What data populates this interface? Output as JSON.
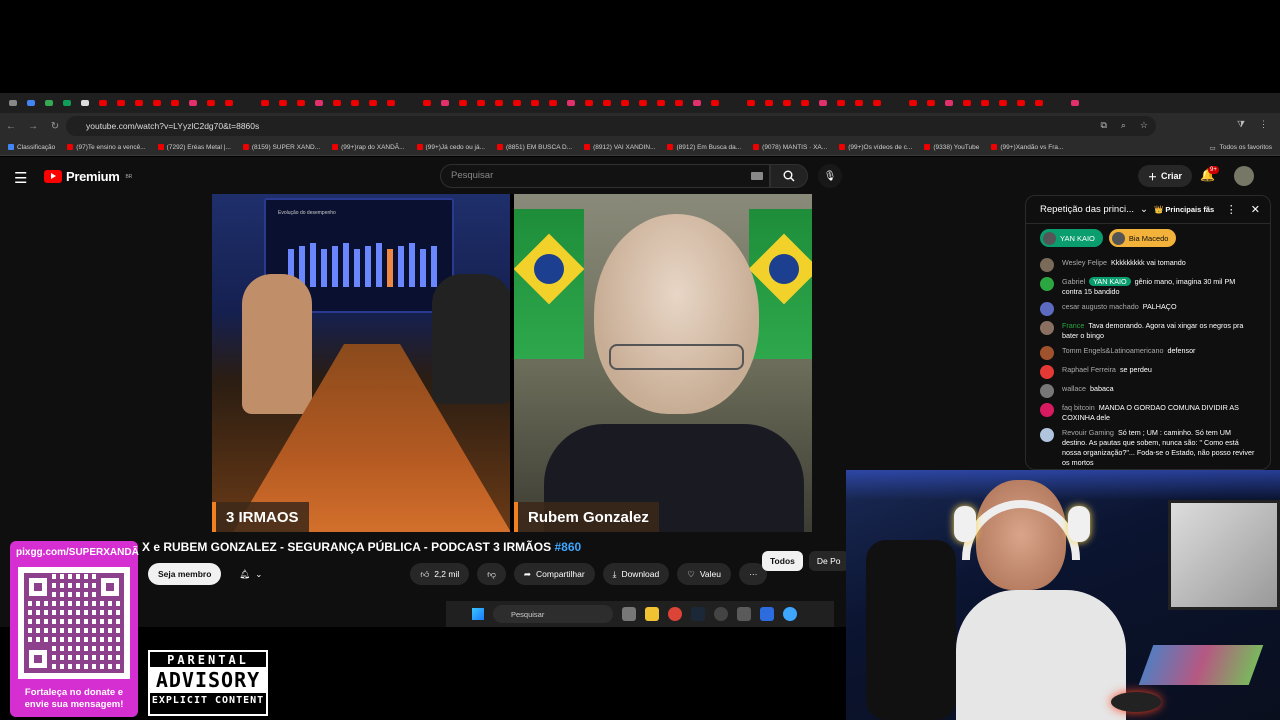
{
  "browser": {
    "url": "youtube.com/watch?v=LYyzlC2dg70&t=8860s",
    "bookmarks": [
      "Classificação",
      "(97)Te ensino a vencê...",
      "(7292) Eréas Metal |...",
      "(8159) SUPER XAND...",
      "(99+)rap do XANDÃ...",
      "(99+)Já cedo ou já...",
      "(8851) EM BUSCA D...",
      "(8912) VAI XANDIN...",
      "(8912) Em Busca da...",
      "(9078) MANTIS · XA...",
      "(99+)Os vídeos de c...",
      "(9338) YouTube",
      "(99+)Xandão vs Fra..."
    ],
    "favorites_label": "Todos os favoritos"
  },
  "youtube": {
    "logo_text": "Premium",
    "logo_sup": "BR",
    "search_placeholder": "Pesquisar",
    "create_label": "Criar",
    "notif_badge": "9+",
    "video": {
      "left_caption": "3 IRMAOS",
      "right_caption": "Rubem Gonzalez",
      "monitor_title": "Evolução do desempenho"
    },
    "title": "X e RUBEM GONZALEZ - SEGURANÇA PÚBLICA - PODCAST 3 IRMÃOS",
    "title_hash": "#860",
    "actions": {
      "member": "Seja membro",
      "likes": "2,2 mil",
      "share": "Compartilhar",
      "download": "Download",
      "thanks": "Valeu"
    },
    "chips": [
      "Todos",
      "De Po"
    ]
  },
  "chat": {
    "header": "Repetição das princi...",
    "fans_label": "Principais fãs",
    "pinned": [
      {
        "name": "YAN KAIO",
        "style": "green"
      },
      {
        "name": "Bia Macedo",
        "style": "gold"
      }
    ],
    "messages": [
      {
        "author": "Wesley Felipe",
        "badge": "",
        "text": "Kkkkkkkkk vai tomando",
        "color": "#7a6a5a"
      },
      {
        "author": "Gabriel",
        "badge": "YAN KAIO",
        "text": "gênio mano, imagina 30 mil PM contra 15 bandido",
        "color": "#2ba640"
      },
      {
        "author": "cesar augusto machado",
        "badge": "",
        "text": "PALHAÇO",
        "color": "#5c6bc0"
      },
      {
        "author": "France",
        "badge": "",
        "text": "Tava demorando. Agora vai xingar os negros pra bater o bingo",
        "color": "#8a7060",
        "mod": true
      },
      {
        "author": "Tomm Engels&Latinoamericano",
        "badge": "",
        "text": "defensor",
        "color": "#a0522d"
      },
      {
        "author": "Raphael Ferreira",
        "badge": "",
        "text": "se perdeu",
        "color": "#e53935"
      },
      {
        "author": "wallace",
        "badge": "",
        "text": "babaca",
        "color": "#777"
      },
      {
        "author": "faq bitcoin",
        "badge": "",
        "text": "MANDA O GORDAO COMUNA DIVIDIR AS COXINHA dele",
        "color": "#d81b60"
      },
      {
        "author": "Revouir Gaming",
        "badge": "",
        "text": "Só tem ; UM : caminho. Só tem UM destino. As pautas que sobem, nunca são: \" Como está nossa organização?\"... Foda-se o Estado, não posso reviver os mortos",
        "color": "#b0c4de"
      }
    ]
  },
  "taskbar": {
    "search_placeholder": "Pesquisar"
  },
  "overlay": {
    "qr_url": "pixgg.com/SUPERXANDÃ",
    "qr_text_line1": "Fortaleça no donate e",
    "qr_text_line2": "envie sua mensagem!",
    "advisory_top": "PARENTAL",
    "advisory_mid": "ADVISORY",
    "advisory_bottom": "EXPLICIT CONTENT"
  }
}
